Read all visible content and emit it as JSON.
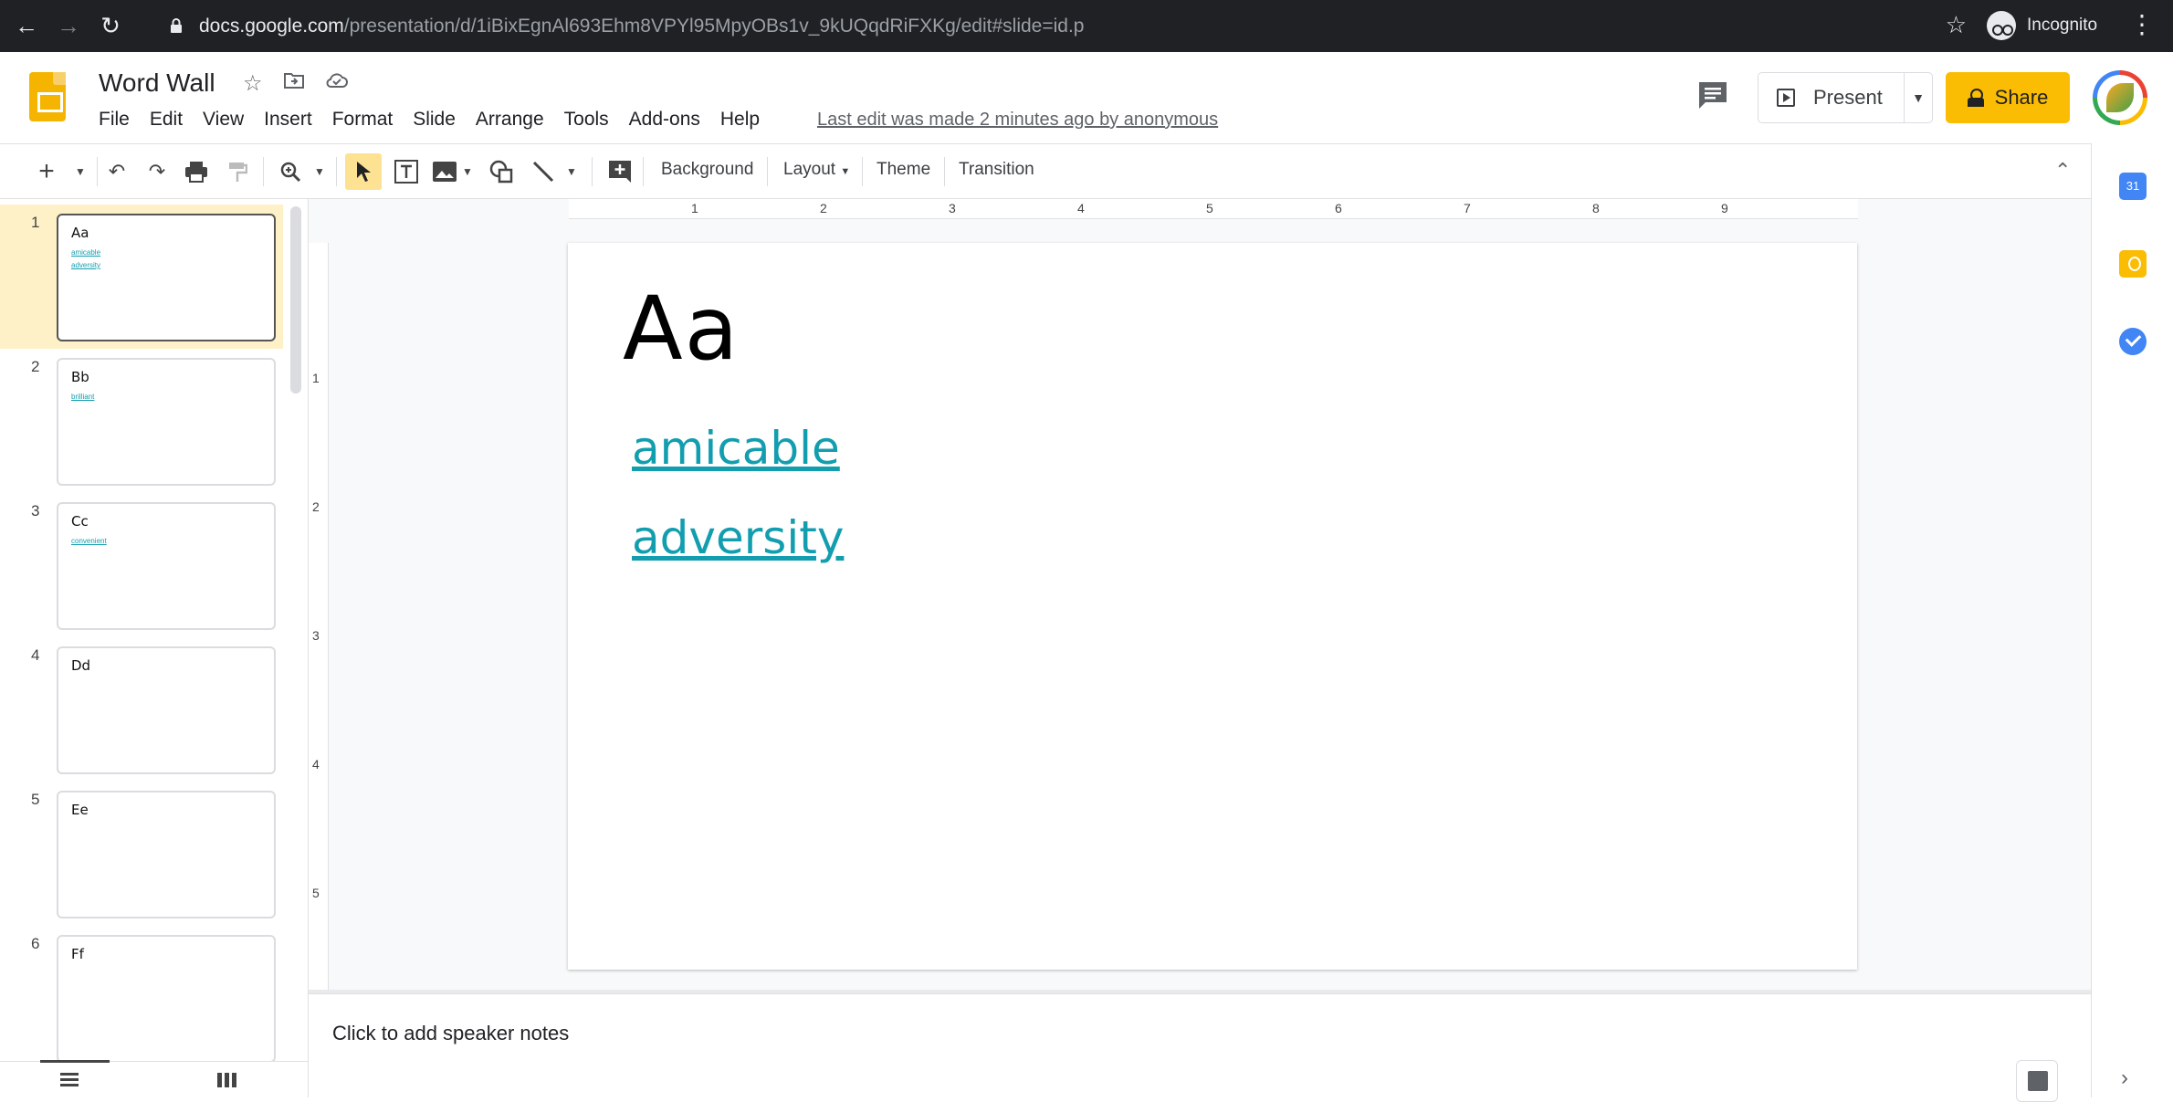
{
  "browser": {
    "url_domain": "docs.google.com",
    "url_path": "/presentation/d/1iBixEgnAl693Ehm8VPYl95MpyOBs1v_9kUQqdRiFXKg/edit#slide=id.p",
    "profile_label": "Incognito"
  },
  "doc": {
    "title": "Word Wall",
    "last_edit": "Last edit was made 2 minutes ago by anonymous"
  },
  "menu": [
    "File",
    "Edit",
    "View",
    "Insert",
    "Format",
    "Slide",
    "Arrange",
    "Tools",
    "Add-ons",
    "Help"
  ],
  "header": {
    "present_label": "Present",
    "share_label": "Share"
  },
  "toolbar": {
    "background_label": "Background",
    "layout_label": "Layout",
    "theme_label": "Theme",
    "transition_label": "Transition"
  },
  "slides": [
    {
      "num": "1",
      "title": "Aa",
      "words": [
        "amicable",
        "adversity"
      ]
    },
    {
      "num": "2",
      "title": "Bb",
      "words": [
        "brilliant"
      ]
    },
    {
      "num": "3",
      "title": "Cc",
      "words": [
        "convenient"
      ]
    },
    {
      "num": "4",
      "title": "Dd",
      "words": []
    },
    {
      "num": "5",
      "title": "Ee",
      "words": []
    },
    {
      "num": "6",
      "title": "Ff",
      "words": []
    }
  ],
  "current_slide": {
    "title": "Aa",
    "words": [
      "amicable",
      "adversity"
    ]
  },
  "ruler": {
    "h": [
      "1",
      "2",
      "3",
      "4",
      "5",
      "6",
      "7",
      "8",
      "9"
    ],
    "v": [
      "1",
      "2",
      "3",
      "4",
      "5"
    ]
  },
  "notes": {
    "placeholder": "Click to add speaker notes"
  },
  "sidepanel": {
    "calendar_label": "31"
  },
  "colors": {
    "accent": "#fbbc04",
    "link": "#129eaf",
    "selected_slide_bg": "#fef0c7"
  }
}
